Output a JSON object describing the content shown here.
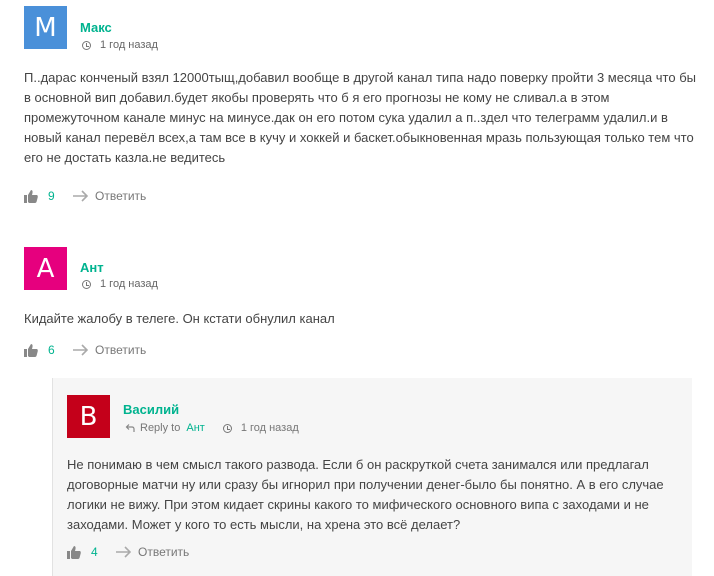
{
  "comments": [
    {
      "author": "Макс",
      "avatar_letter": "M",
      "avatar_color": "#4a90d9",
      "time": "1 год назад",
      "text": "П..дарас конченый взял 12000тыщ,добавил вообще в другой канал типа надо поверку пройти 3 месяца что бы в основной вип добавил.будет якобы проверять что б я его прогнозы не кому не сливал.а в этом промежуточном канале минус на минусе.дак он его потом сука удалил а п..здел что телеграмм удалил.и в новый канал перевёл всех,а там все в кучу и хоккей и баскет.обыкновенная мразь пользующая только тем что его не достать казла.не ведитесь",
      "votes": "9",
      "reply_label": "Ответить"
    },
    {
      "author": "Ант",
      "avatar_letter": "A",
      "avatar_color": "#e6007e",
      "time": "1 год назад",
      "text": "Кидайте жалобу в телеге. Он кстати обнулил канал",
      "votes": "6",
      "reply_label": "Ответить"
    }
  ],
  "reply": {
    "author": "Василий",
    "avatar_letter": "B",
    "avatar_color": "#c4001a",
    "reply_to_label": "Reply to",
    "reply_to_name": "Ант",
    "time": "1 год назад",
    "text": "Не понимаю в чем смысл такого развода. Если б он раскруткой счета занимался или предлагал договорные матчи ну или сразу бы игнорил при получении денег-было бы понятно. А в его случае логики не вижу. При этом кидает скрины какого то мифического основного випа с заходами и не заходами. Может у кого то есть мысли, на хрена это всё делает?",
    "votes": "4",
    "reply_label": "Ответить"
  }
}
